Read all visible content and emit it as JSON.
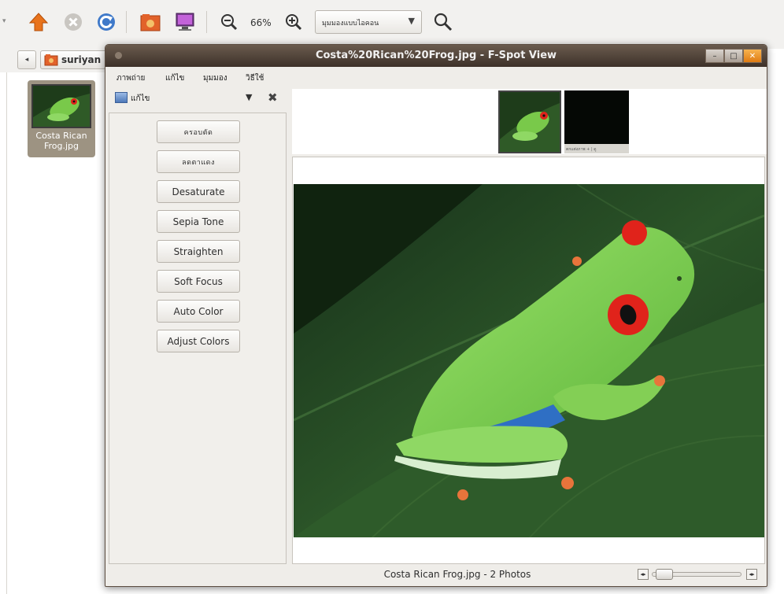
{
  "toolbar": {
    "zoom_level": "66%",
    "view_mode": "มุมมองแบบไอคอน",
    "view_mode_arrow": "▼",
    "overflow_arrow": "▾"
  },
  "location": {
    "back_arrow": "◂",
    "folder_label": "suriyan"
  },
  "thumbnail": {
    "caption_line1": "Costa Rican",
    "caption_line2": "Frog.jpg"
  },
  "dialog": {
    "title": "Costa%20Rican%20Frog.jpg - F-Spot View",
    "controls": {
      "minimize": "–",
      "maximize": "□",
      "close": "✕"
    },
    "menu": [
      "ภาพถ่าย",
      "แก้ไข",
      "มุมมอง",
      "วิธีใช้"
    ],
    "sidebar": {
      "header_label": "แก้ไข",
      "header_dropdown": "▼",
      "header_close": "✖",
      "buttons": [
        "ครอบตัด",
        "ลดตาแดง",
        "Desaturate",
        "Sepia Tone",
        "Straighten",
        "Soft Focus",
        "Auto Color",
        "Adjust Colors"
      ]
    },
    "filmstrip": {
      "thumb2_caption": "ตกแต่งภาพ +  |  ดู"
    },
    "status": "Costa Rican Frog.jpg  -  2 Photos",
    "zoom": {
      "min_label": "◂▸",
      "max_label": "◂▸",
      "value": 0.05
    }
  },
  "colors": {
    "titlebar": "#4f4136",
    "accent_orange": "#e07b12",
    "frog_green": "#7ccd4c",
    "frog_eye": "#e0231b"
  }
}
